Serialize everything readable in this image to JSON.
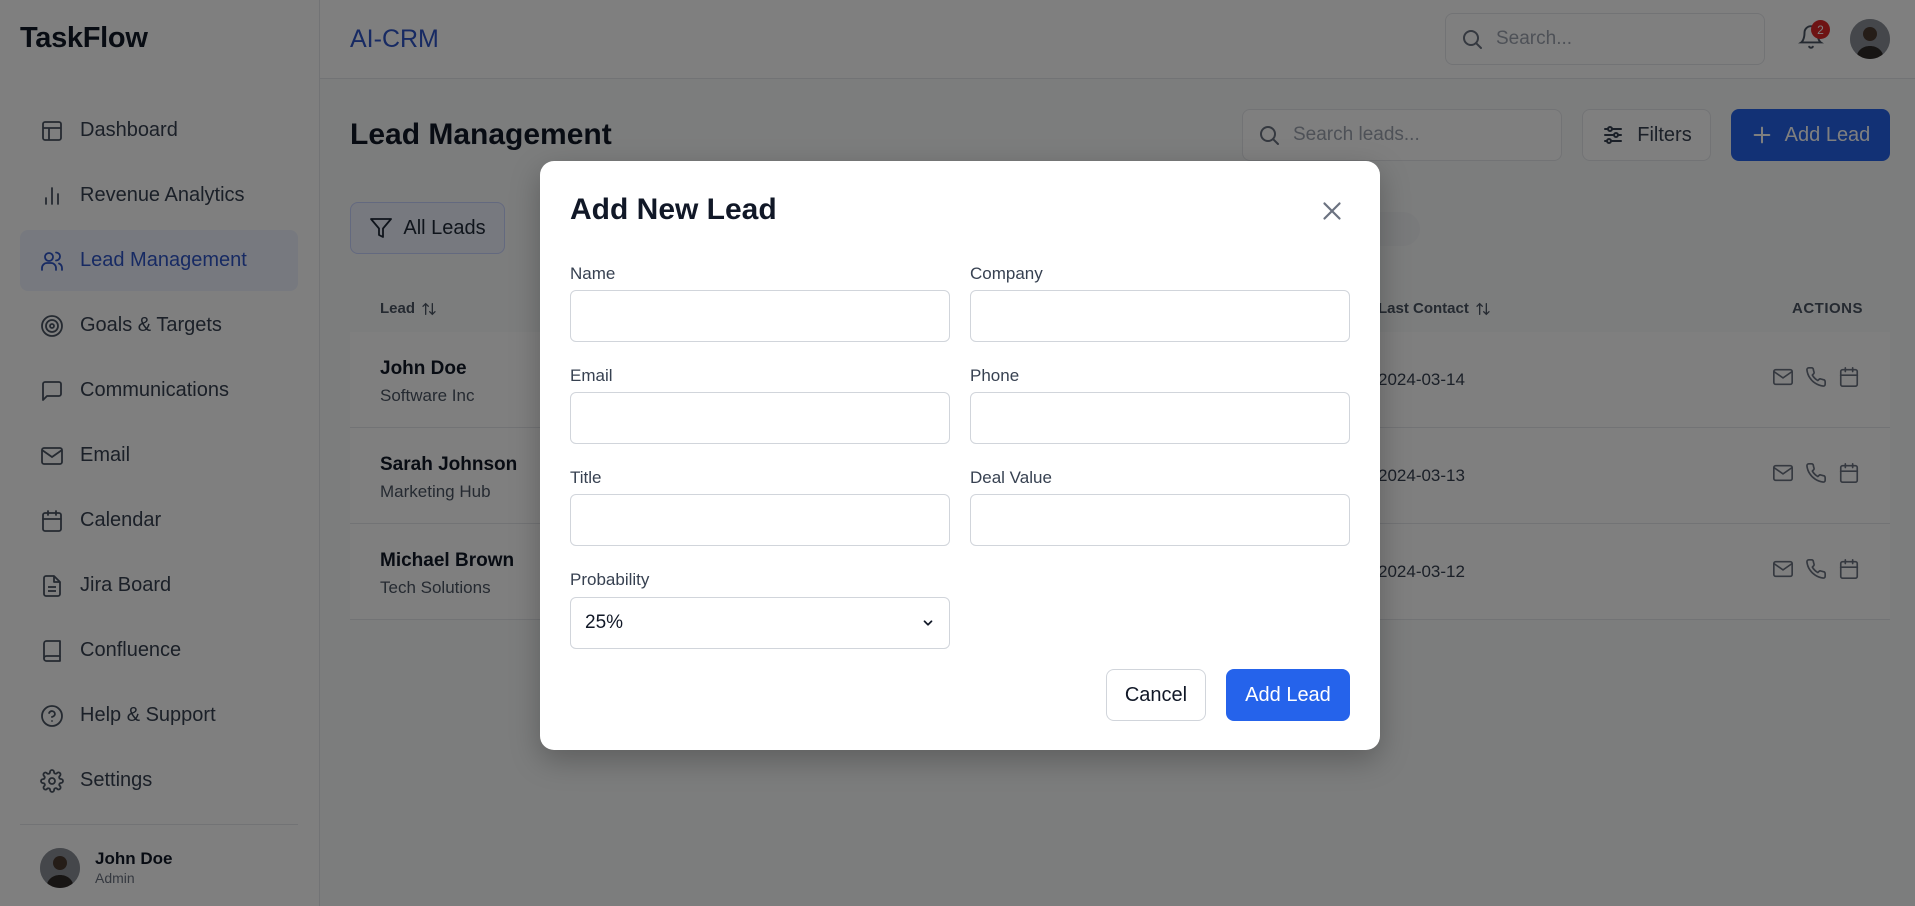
{
  "app": {
    "logo": "TaskFlow",
    "brand": "AI-CRM"
  },
  "sidebar": {
    "items": [
      {
        "label": "Dashboard",
        "icon": "layout-icon"
      },
      {
        "label": "Revenue Analytics",
        "icon": "bar-chart-icon"
      },
      {
        "label": "Lead Management",
        "icon": "users-icon",
        "active": true
      },
      {
        "label": "Goals & Targets",
        "icon": "target-icon"
      },
      {
        "label": "Communications",
        "icon": "message-icon"
      },
      {
        "label": "Email",
        "icon": "mail-icon"
      },
      {
        "label": "Calendar",
        "icon": "calendar-icon"
      },
      {
        "label": "Jira Board",
        "icon": "file-icon"
      },
      {
        "label": "Confluence",
        "icon": "book-icon"
      },
      {
        "label": "Help & Support",
        "icon": "help-icon"
      },
      {
        "label": "Settings",
        "icon": "gear-icon"
      }
    ],
    "user": {
      "name": "John Doe",
      "role": "Admin"
    }
  },
  "header": {
    "search_placeholder": "Search...",
    "notifications_count": "2"
  },
  "main": {
    "title": "Lead Management",
    "search_placeholder": "Search leads...",
    "filters_label": "Filters",
    "add_lead_label": "Add Lead",
    "filter_chip": "All Leads",
    "partial_chip_text": ")",
    "columns": {
      "lead": "Lead",
      "last_contact": "Last Contact",
      "actions": "ACTIONS"
    },
    "rows": [
      {
        "name": "John Doe",
        "company": "Software Inc",
        "last_contact": "2024-03-14"
      },
      {
        "name": "Sarah Johnson",
        "company": "Marketing Hub",
        "last_contact": "2024-03-13"
      },
      {
        "name": "Michael Brown",
        "company": "Tech Solutions",
        "last_contact": "2024-03-12"
      }
    ]
  },
  "modal": {
    "title": "Add New Lead",
    "fields": {
      "name": {
        "label": "Name",
        "value": ""
      },
      "company": {
        "label": "Company",
        "value": ""
      },
      "email": {
        "label": "Email",
        "value": ""
      },
      "phone": {
        "label": "Phone",
        "value": ""
      },
      "title": {
        "label": "Title",
        "value": ""
      },
      "deal_value": {
        "label": "Deal Value",
        "value": ""
      },
      "probability": {
        "label": "Probability",
        "value": "25%"
      }
    },
    "cancel_label": "Cancel",
    "submit_label": "Add Lead"
  },
  "colors": {
    "accent": "#2563eb",
    "brand": "#2f55c6",
    "badge": "#dc2626"
  }
}
